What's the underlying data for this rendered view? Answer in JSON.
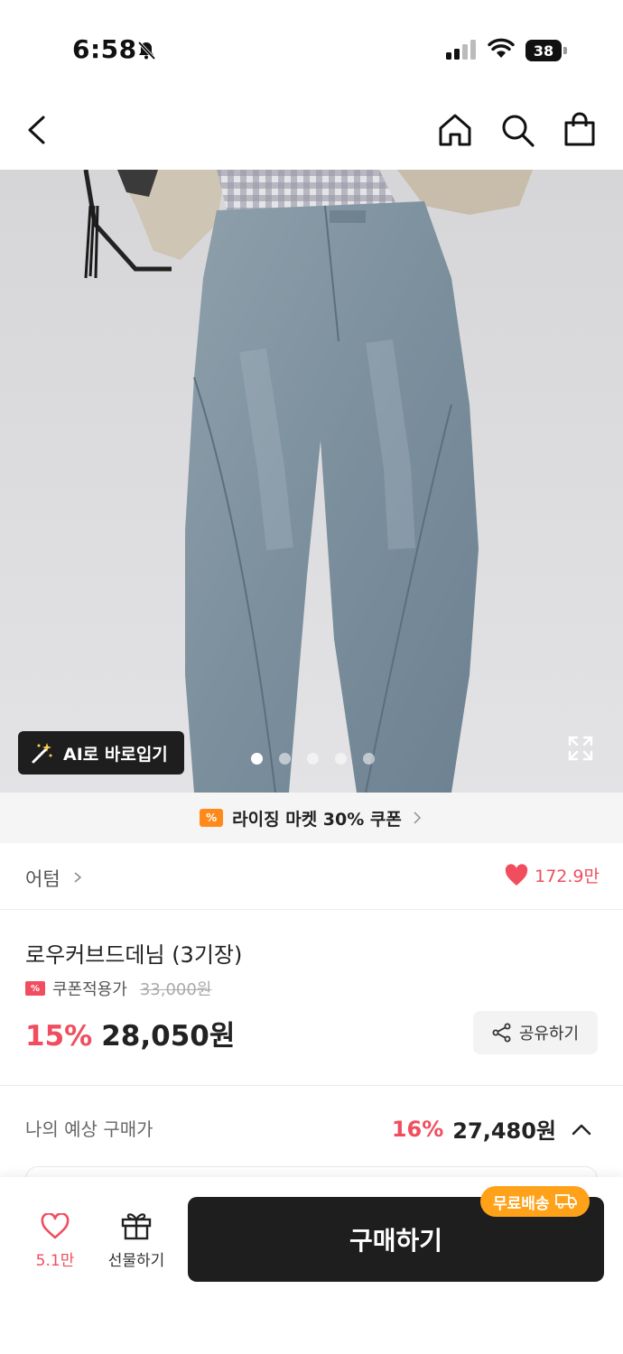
{
  "status_bar": {
    "time": "6:58",
    "battery": "38"
  },
  "nav": {
    "back_icon": "chevron-left-icon",
    "home_icon": "home-icon",
    "search_icon": "search-icon",
    "bag_icon": "shopping-bag-icon"
  },
  "hero": {
    "ai_button_label": "AI로 바로입기",
    "dots_count": 5,
    "active_dot": 0
  },
  "coupon_banner": {
    "text": "라이징 마켓 30% 쿠폰"
  },
  "brand": {
    "name": "어텀",
    "likes": "172.9만"
  },
  "product": {
    "name": "로우커브드데님 (3기장)",
    "coupon_label": "쿠폰적용가",
    "original_price": "33,000원",
    "discount": "15%",
    "price": "28,050원",
    "share_label": "공유하기"
  },
  "expected": {
    "label": "나의 예상 구매가",
    "discount": "16%",
    "amount": "27,480원"
  },
  "bottom_bar": {
    "wish_count": "5.1만",
    "gift_label": "선물하기",
    "buy_label": "구매하기",
    "free_shipping": "무료배송"
  },
  "colors": {
    "accent": "#f04e5e",
    "dark": "#1e1e1e",
    "orange": "#ffa21a"
  }
}
